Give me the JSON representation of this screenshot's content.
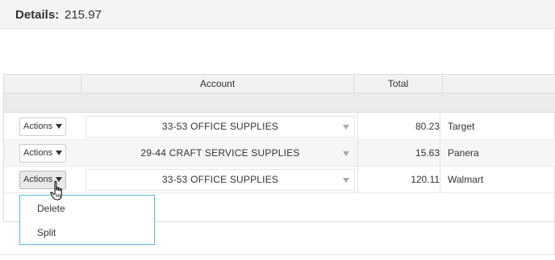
{
  "details": {
    "label": "Details:",
    "amount": "215.97"
  },
  "table": {
    "columns": [
      "",
      "Account",
      "Total",
      ""
    ],
    "rows": [
      {
        "actions_label": "Actions",
        "account": "33-53 OFFICE SUPPLIES",
        "total": "80.23",
        "vendor": "Target"
      },
      {
        "actions_label": "Actions",
        "account": "29-44 CRAFT SERVICE SUPPLIES",
        "total": "15.63",
        "vendor": "Panera"
      },
      {
        "actions_label": "Actions",
        "account": "33-53 OFFICE SUPPLIES",
        "total": "120.11",
        "vendor": "Walmart"
      }
    ]
  },
  "actions_menu": {
    "items": [
      "Delete",
      "Split"
    ]
  },
  "icons": {
    "actions_caret": "caret-down-icon",
    "select_caret": "chevron-down-icon",
    "cursor": "hand-pointer-cursor-icon"
  },
  "colors": {
    "dropdown_border": "#5bc0de",
    "header_bg": "#f2f2f2",
    "details_bg": "#f4f4f4"
  }
}
